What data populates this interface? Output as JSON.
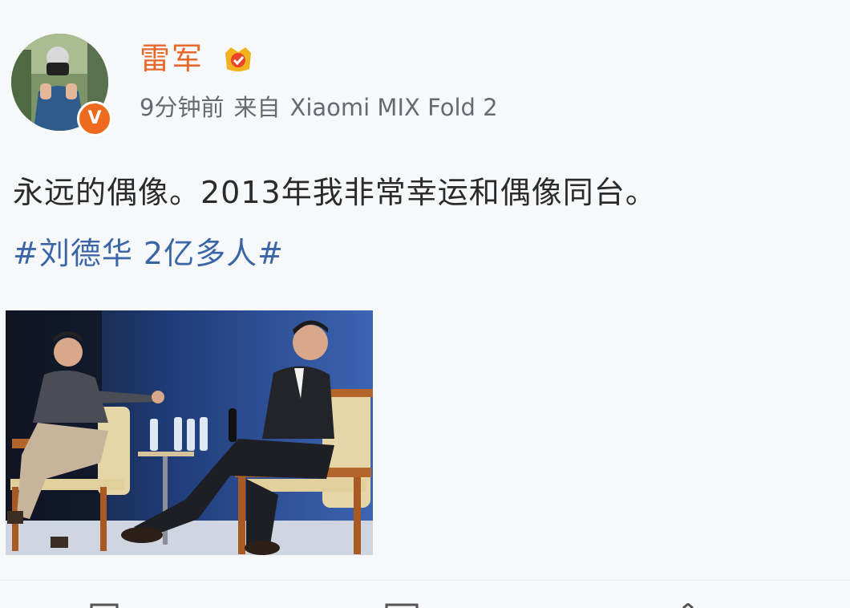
{
  "post": {
    "username": "雷军",
    "time": "9分钟前",
    "source_prefix": "来自",
    "device": "Xiaomi MIX Fold 2",
    "text": "永远的偶像。2013年我非常幸运和偶像同台。",
    "hashtag": "#刘德华 2亿多人#"
  },
  "badges": {
    "verified_letter": "V",
    "verified_color": "#ee6a1f",
    "vip_color": "#f0b31e"
  },
  "colors": {
    "username": "#e8682a",
    "hashtag": "#3a66a8",
    "meta": "#666a72",
    "text": "#2b2b2b"
  },
  "icons": {
    "avatar": "user-avatar-photo",
    "verified": "verified-v-badge-icon",
    "vip": "vip-crown-badge-icon",
    "toolbar": [
      "repost-icon",
      "comment-icon",
      "like-icon"
    ]
  }
}
